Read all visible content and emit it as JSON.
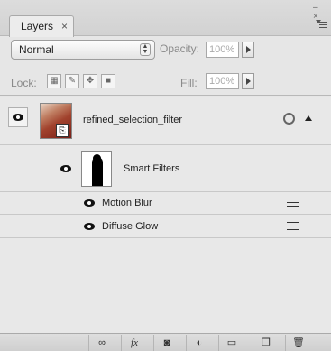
{
  "panel": {
    "tab_label": "Layers",
    "close_glyph": "×",
    "collapse_glyph": "– ×"
  },
  "controls": {
    "blend_mode": "Normal",
    "opacity_label": "Opacity:",
    "opacity_value": "100%",
    "lock_label": "Lock:",
    "fill_label": "Fill:",
    "fill_value": "100%"
  },
  "layers": [
    {
      "name": "refined_selection_filter",
      "visible": true,
      "smart_filters_label": "Smart Filters",
      "filters": [
        {
          "name": "Motion Blur"
        },
        {
          "name": "Diffuse Glow"
        }
      ]
    }
  ],
  "bottom_toolbar": {
    "buttons": [
      {
        "icon": "link-icon",
        "glyph": "∞"
      },
      {
        "icon": "fx-icon",
        "glyph": "fx"
      },
      {
        "icon": "mask-icon",
        "glyph": "◙"
      },
      {
        "icon": "adjustment-icon",
        "glyph": "◐"
      },
      {
        "icon": "group-folder-icon",
        "glyph": "▭"
      },
      {
        "icon": "new-layer-icon",
        "glyph": "❐"
      },
      {
        "icon": "trash-icon",
        "glyph": "🗑"
      }
    ]
  },
  "colors": {
    "panel_bg": "#e6e6e6",
    "thumb_red": "#a1422d"
  }
}
